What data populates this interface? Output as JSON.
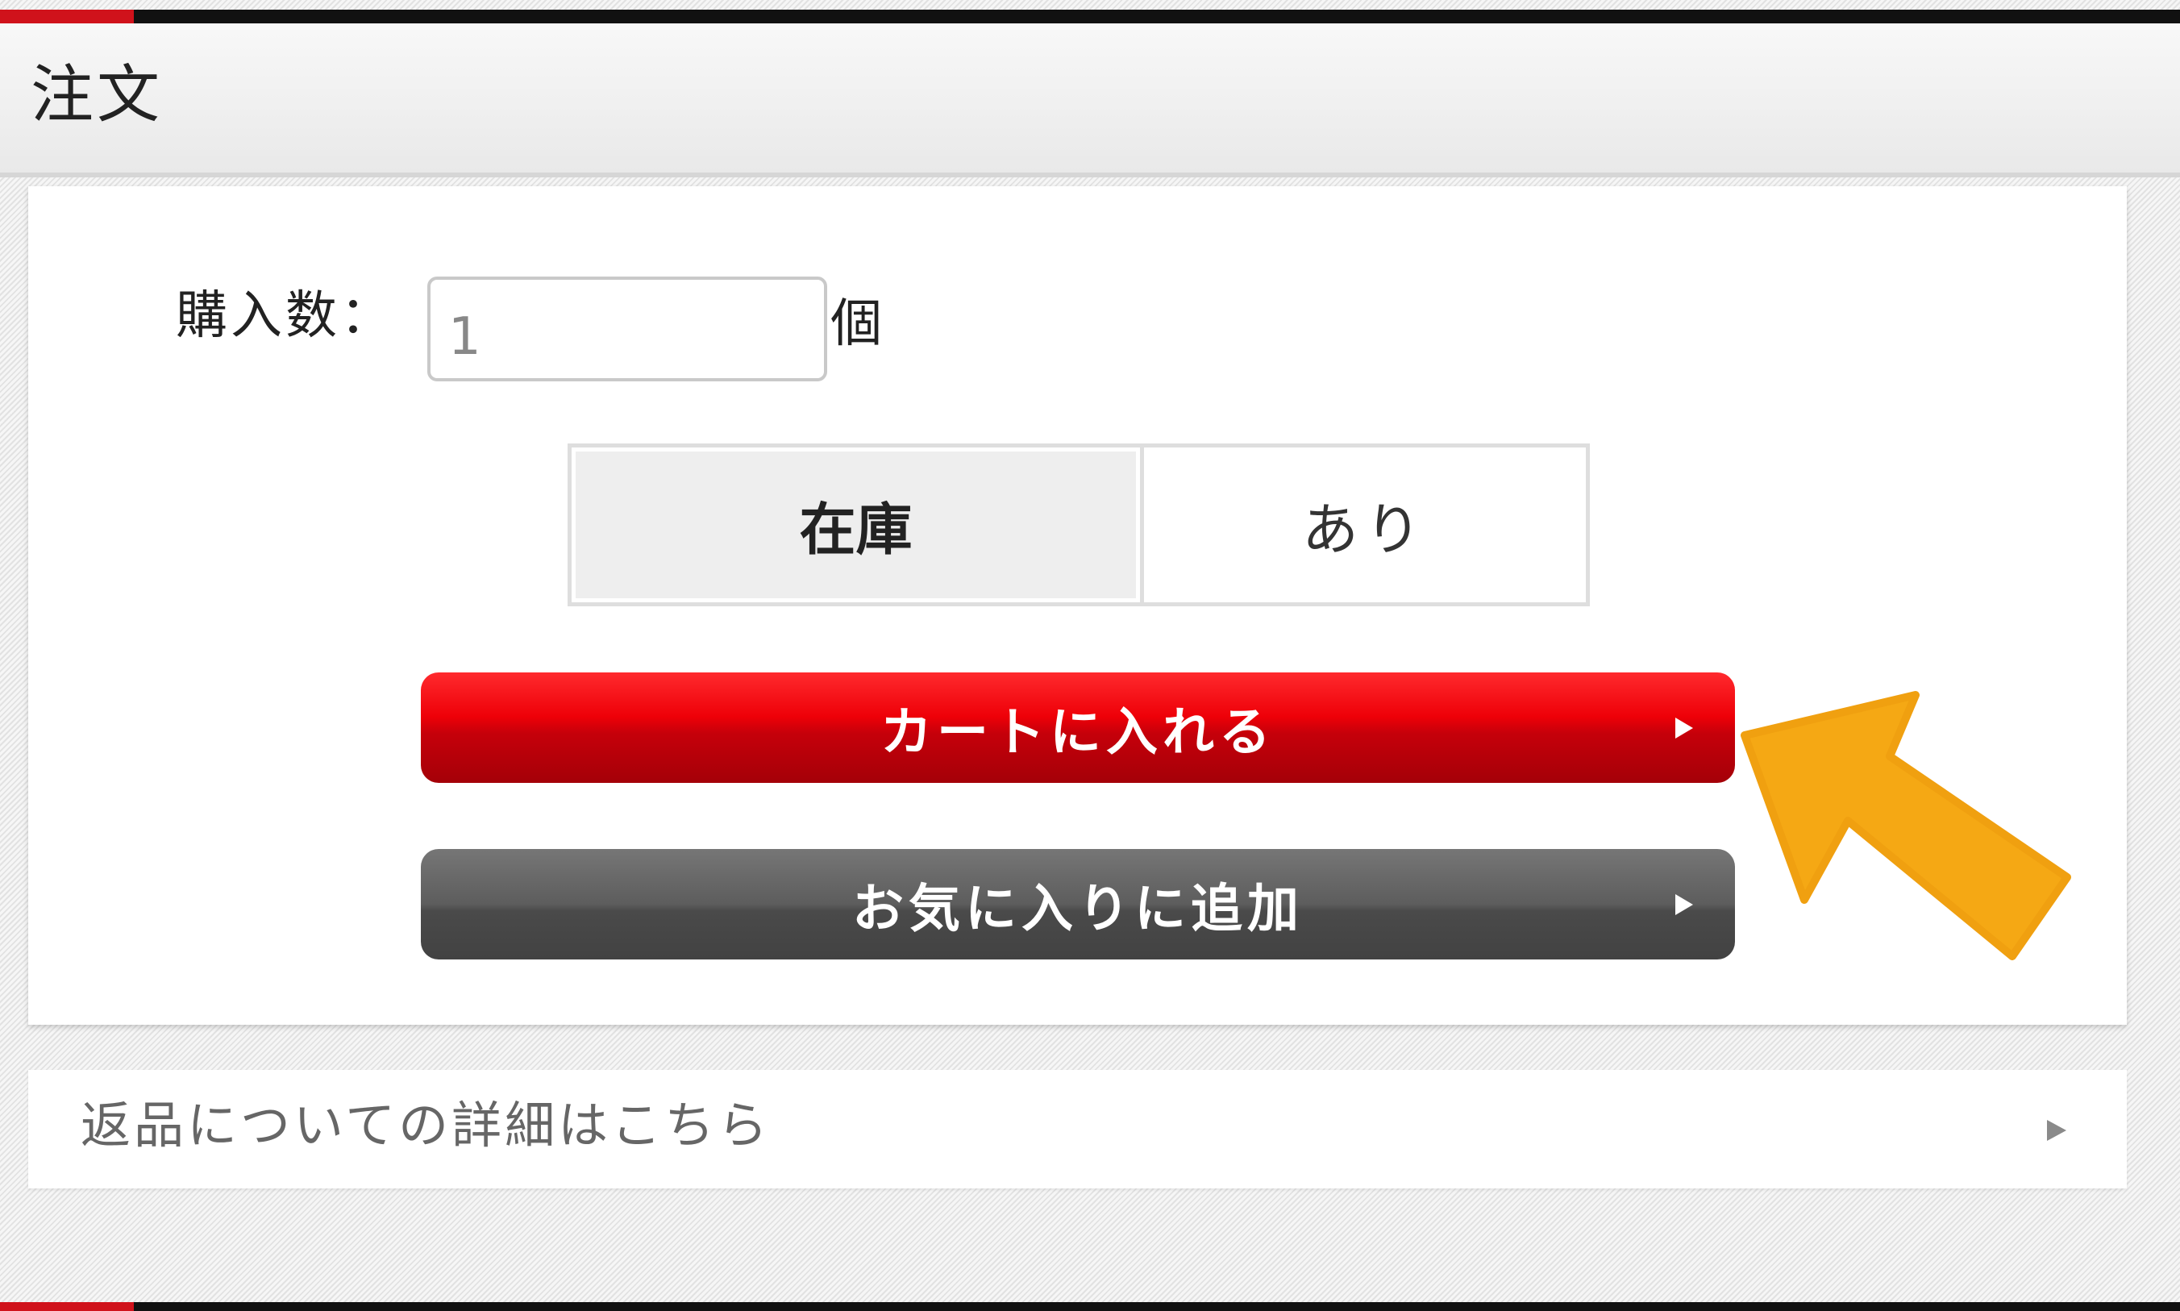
{
  "header": {
    "title": "注文"
  },
  "order": {
    "quantity_label": "購入数：",
    "quantity_value": "1",
    "quantity_unit": "個"
  },
  "stock": {
    "key": "在庫",
    "value": "あり"
  },
  "buttons": {
    "add_to_cart": "カートに入れる",
    "add_to_favorites": "お気に入りに追加"
  },
  "returns": {
    "label": "返品についての詳細はこちら"
  },
  "colors": {
    "accent_red": "#d0121b",
    "cart_button": "#ee0008",
    "favorites_button": "#5d5d5d",
    "annotation_arrow": "#f5a814"
  },
  "icons": {
    "button_arrow": "play-triangle-icon",
    "annotation": "orange-pointer-arrow-icon"
  }
}
